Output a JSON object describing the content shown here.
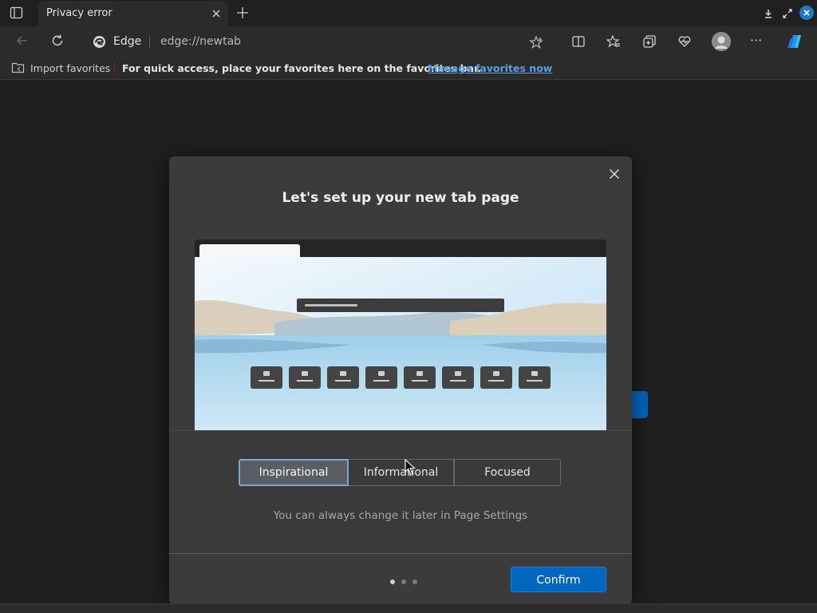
{
  "browser": {
    "tab": {
      "title": "Privacy error"
    },
    "address": {
      "brand": "Edge",
      "url": "edge://newtab"
    },
    "favorites_bar": {
      "import_label": "Import favorites",
      "prompt": "For quick access, place your favorites here on the favorites bar.",
      "manage_link": "Manage favorites now"
    },
    "more_label": "···"
  },
  "dialog": {
    "title": "Let's set up your new tab page",
    "layout_options": [
      {
        "label": "Inspirational",
        "selected": true
      },
      {
        "label": "Informational",
        "selected": false
      },
      {
        "label": "Focused",
        "selected": false
      }
    ],
    "hint": "You can always change it later in Page Settings",
    "steps": {
      "current": 1,
      "total": 3
    },
    "confirm_label": "Confirm"
  },
  "colors": {
    "accent": "#0067c0",
    "selected_outline": "#7aa6d9",
    "link": "#5aa0e0"
  },
  "icons": {
    "tab_actions": "tab-actions-icon",
    "tab_close": "close-icon",
    "new_tab": "plus-icon",
    "back": "back-arrow-icon",
    "refresh": "refresh-icon",
    "favorite_star": "star-icon",
    "split_screen": "split-screen-icon",
    "favorites": "favorites-icon",
    "collections": "collections-icon",
    "performance": "heartbeat-icon",
    "profile": "avatar-icon",
    "copilot": "copilot-icon",
    "import": "folder-icon",
    "dialog_close": "close-icon"
  }
}
